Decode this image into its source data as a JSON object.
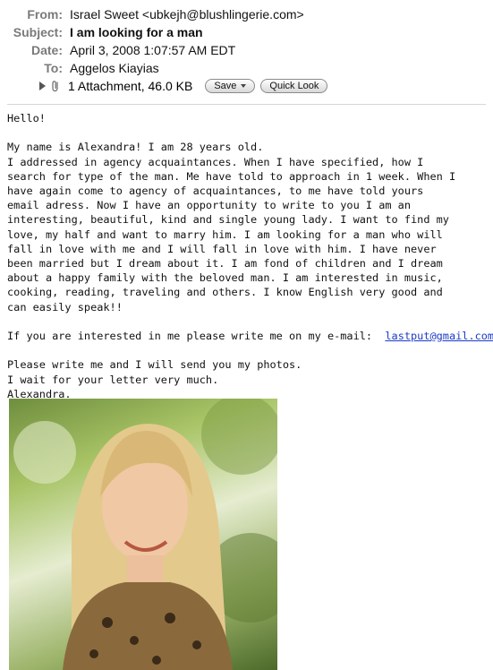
{
  "header": {
    "from_label": "From:",
    "from_value": "Israel Sweet <ubkejh@blushlingerie.com>",
    "subject_label": "Subject:",
    "subject_value": "I am looking for a man",
    "date_label": "Date:",
    "date_value": "April 3, 2008 1:07:57 AM EDT",
    "to_label": "To:",
    "to_value": "Aggelos Kiayias"
  },
  "attachment": {
    "summary": "1 Attachment, 46.0 KB",
    "save_label": "Save",
    "quicklook_label": "Quick Look"
  },
  "body": {
    "greeting": "Hello!",
    "intro": "My name is Alexandra! I am 28 years old.\nI addressed in agency acquaintances. When I have specified, how I\nsearch for type of the man. Me have told to approach in 1 week. When I\nhave again come to agency of acquaintances, to me have told yours\nemail adress. Now I have an opportunity to write to you I am an\ninteresting, beautiful, kind and single young lady. I want to find my\nlove, my half and want to marry him. I am looking for a man who will\nfall in love with me and I will fall in love with him. I have never\nbeen married but I dream about it. I am fond of children and I dream\nabout a happy family with the beloved man. I am interested in music,\ncooking, reading, traveling and others. I know English very good and\ncan easily speak!!",
    "contact_prefix": "If you are interested in me please write me on my e-mail:  ",
    "contact_email": "lastput@gmail.com",
    "closing": "Please write me and I will send you my photos.\nI wait for your letter very much.\nAlexandra."
  }
}
